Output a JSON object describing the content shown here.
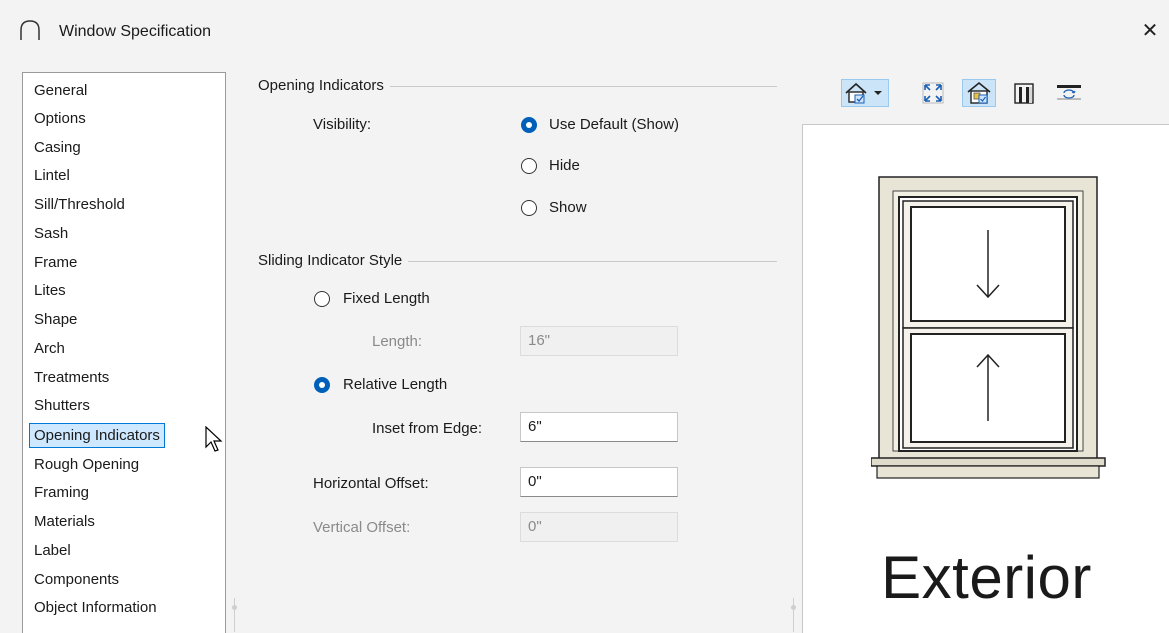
{
  "window": {
    "title": "Window Specification",
    "close_icon": "close-icon"
  },
  "sidebar": {
    "items": [
      {
        "label": "General"
      },
      {
        "label": "Options"
      },
      {
        "label": "Casing"
      },
      {
        "label": "Lintel"
      },
      {
        "label": "Sill/Threshold"
      },
      {
        "label": "Sash"
      },
      {
        "label": "Frame"
      },
      {
        "label": "Lites"
      },
      {
        "label": "Shape"
      },
      {
        "label": "Arch"
      },
      {
        "label": "Treatments"
      },
      {
        "label": "Shutters"
      },
      {
        "label": "Opening Indicators",
        "selected": true
      },
      {
        "label": "Rough Opening"
      },
      {
        "label": "Framing"
      },
      {
        "label": "Materials"
      },
      {
        "label": "Label"
      },
      {
        "label": "Components"
      },
      {
        "label": "Object Information"
      }
    ]
  },
  "opening_indicators": {
    "group_title": "Opening Indicators",
    "visibility_label": "Visibility:",
    "options": [
      {
        "label": "Use Default (Show)",
        "checked": true
      },
      {
        "label": "Hide",
        "checked": false
      },
      {
        "label": "Show",
        "checked": false
      }
    ]
  },
  "sliding": {
    "group_title": "Sliding Indicator Style",
    "fixed_length_label": "Fixed Length",
    "fixed_length_checked": false,
    "length_label": "Length:",
    "length_value": "16\"",
    "relative_length_label": "Relative Length",
    "relative_length_checked": true,
    "inset_label": "Inset from Edge:",
    "inset_value": "6\"",
    "horizontal_offset_label": "Horizontal Offset:",
    "horizontal_offset_value": "0\"",
    "vertical_offset_label": "Vertical Offset:",
    "vertical_offset_value": "0\""
  },
  "preview": {
    "caption": "Exterior",
    "toolbar": [
      "house-view-dropdown-icon",
      "fill-window-icon",
      "camera-view-icon",
      "section-view-icon",
      "swap-side-icon"
    ]
  },
  "colors": {
    "accent": "#005fb8",
    "selection_bg": "#cde8ff",
    "selection_border": "#0078d7"
  }
}
